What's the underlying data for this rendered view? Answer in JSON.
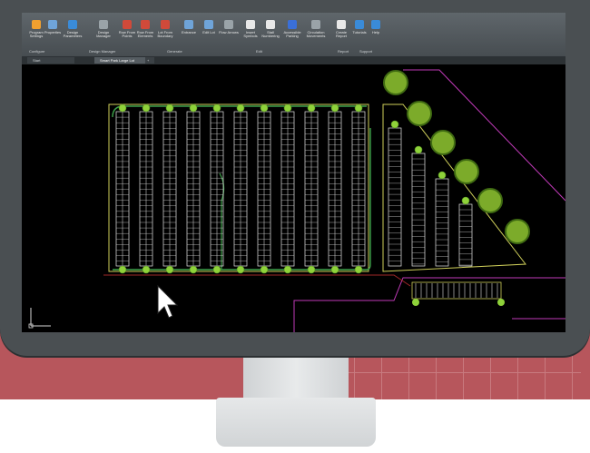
{
  "ribbon": {
    "buttons": [
      {
        "label": "Program Settings",
        "color": "#f0a030"
      },
      {
        "label": "Properties",
        "color": "#6fa4d9"
      },
      {
        "label": "Design Parameters",
        "color": "#3a8bd8"
      },
      {
        "label": "Design Manager",
        "color": "#9aa3a8"
      },
      {
        "label": "Row From Points",
        "color": "#d04a3a"
      },
      {
        "label": "Row From Elements",
        "color": "#d04a3a"
      },
      {
        "label": "Lot From Boundary",
        "color": "#d04a3a"
      },
      {
        "label": "Entrance",
        "color": "#6fa4d9"
      },
      {
        "label": "Edit Lot",
        "color": "#6fa4d9"
      },
      {
        "label": "Flow Arrows",
        "color": "#9aa3a8"
      },
      {
        "label": "Insert Symbols",
        "color": "#e8e8e8"
      },
      {
        "label": "Stall Numbering",
        "color": "#e8e8e8"
      },
      {
        "label": "Accessible Parking",
        "color": "#3a6fd8"
      },
      {
        "label": "Circulation Movements",
        "color": "#9aa3a8"
      },
      {
        "label": "Create Report",
        "color": "#e8e8e8"
      },
      {
        "label": "Tutorials",
        "color": "#3a8bd8"
      },
      {
        "label": "Help",
        "color": "#3a8bd8"
      }
    ],
    "groups": [
      "Configure",
      "Design Manager",
      "Generate",
      "Edit",
      "Report",
      "Support"
    ]
  },
  "tabs": [
    "Start",
    "Smart Park Large Lot"
  ],
  "drawing": {
    "stalls_per_row": 12,
    "double_rows": 11,
    "diagonal_rows": 4,
    "trees_right": 6
  }
}
